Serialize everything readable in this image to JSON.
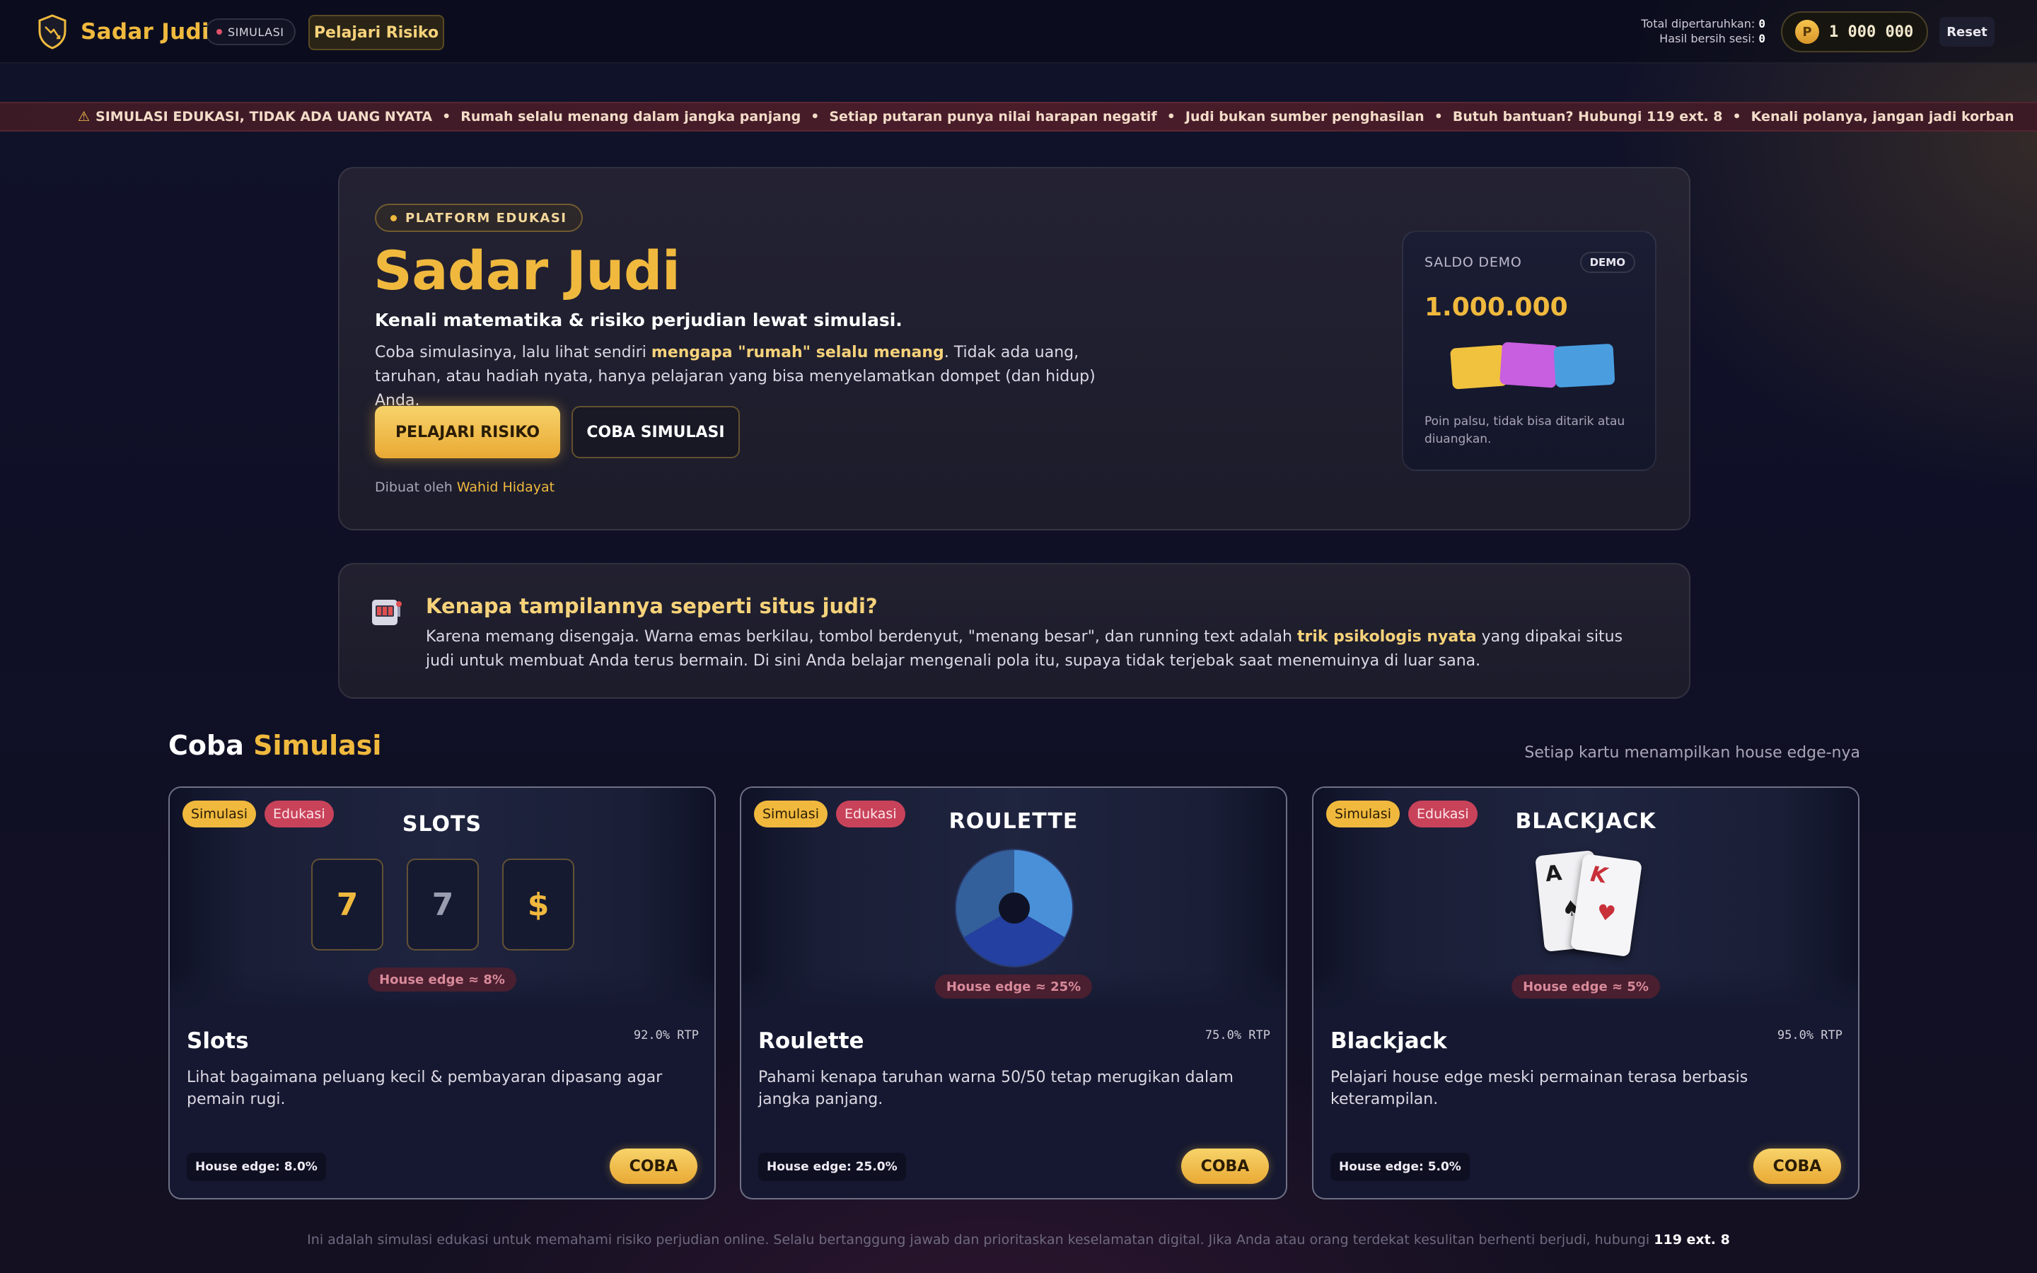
{
  "header": {
    "brand": "Sadar Judi",
    "sim_badge": "SIMULASI",
    "learn_button": "Pelajari Risiko",
    "total_bet_label": "Total dipertaruhkan:",
    "total_bet_value": "0",
    "net_result_label": "Hasil bersih sesi:",
    "net_result_value": "0",
    "coin_symbol": "P",
    "balance": "1 000 000",
    "reset_button": "Reset"
  },
  "ticker": {
    "warning_icon": "warning-icon",
    "items": [
      "SIMULASI EDUKASI, TIDAK ADA UANG NYATA",
      "Rumah selalu menang dalam jangka panjang",
      "Setiap putaran punya nilai harapan negatif",
      "Judi bukan sumber penghasilan",
      "Butuh bantuan? Hubungi 119 ext. 8",
      "Kenali polanya, jangan jadi korban"
    ],
    "separator": "•"
  },
  "hero": {
    "badge": "PLATFORM EDUKASI",
    "title": "Sadar Judi",
    "subtitle": "Kenali matematika & risiko perjudian lewat simulasi.",
    "desc_part1": "Coba simulasinya, lalu lihat sendiri ",
    "desc_highlight": "mengapa \"rumah\" selalu menang",
    "desc_part2": ". Tidak ada uang, taruhan, atau hadiah nyata, hanya pelajaran yang bisa menyelamatkan dompet (dan hidup) Anda.",
    "primary_button": "PELAJARI RISIKO",
    "secondary_button": "COBA SIMULASI",
    "credit_prefix": "Dibuat oleh",
    "credit_name": "Wahid Hidayat"
  },
  "demo": {
    "label": "SALDO DEMO",
    "tag": "DEMO",
    "value": "1.000.000",
    "note": "Poin palsu, tidak bisa ditarik atau diuangkan.",
    "card_colors": [
      "#f0c23e",
      "#c85ee0",
      "#4a9ee0"
    ]
  },
  "why": {
    "icon": "slot-machine-icon",
    "title": "Kenapa tampilannya seperti situs judi?",
    "text_part1": "Karena memang disengaja. Warna emas berkilau, tombol berdenyut, \"menang besar\", dan running text adalah ",
    "text_highlight": "trik psikologis nyata",
    "text_part2": " yang dipakai situs judi untuk membuat Anda terus bermain. Di sini Anda belajar mengenali pola itu, supaya tidak terjebak saat menemuinya di luar sana."
  },
  "section": {
    "title_plain": "Coba ",
    "title_gold": "Simulasi",
    "note": "Setiap kartu menampilkan house edge-nya"
  },
  "games": [
    {
      "tag_sim": "Simulasi",
      "tag_edu": "Edukasi",
      "art_title": "SLOTS",
      "reels": [
        "7",
        "7",
        "$"
      ],
      "edge_chip": "House edge ≈ 8%",
      "title": "Slots",
      "rtp": "92.0% RTP",
      "desc": "Lihat bagaimana peluang kecil & pembayaran dipasang agar pemain rugi.",
      "house_edge": "House edge: 8.0%",
      "button": "COBA"
    },
    {
      "tag_sim": "Simulasi",
      "tag_edu": "Edukasi",
      "art_title": "ROULETTE",
      "edge_chip": "House edge ≈ 25%",
      "title": "Roulette",
      "rtp": "75.0% RTP",
      "desc": "Pahami kenapa taruhan warna 50/50 tetap merugikan dalam jangka panjang.",
      "house_edge": "House edge: 25.0%",
      "button": "COBA"
    },
    {
      "tag_sim": "Simulasi",
      "tag_edu": "Edukasi",
      "art_title": "BLACKJACK",
      "card1": "A",
      "card2": "K",
      "edge_chip": "House edge ≈ 5%",
      "title": "Blackjack",
      "rtp": "95.0% RTP",
      "desc": "Pelajari house edge meski permainan terasa berbasis keterampilan.",
      "house_edge": "House edge: 5.0%",
      "button": "COBA"
    }
  ],
  "footer": {
    "text": "Ini adalah simulasi edukasi untuk memahami risiko perjudian online. Selalu bertanggung jawab dan prioritaskan keselamatan digital. Jika Anda atau orang terdekat kesulitan berhenti berjudi, hubungi",
    "hotline": "119 ext. 8"
  }
}
